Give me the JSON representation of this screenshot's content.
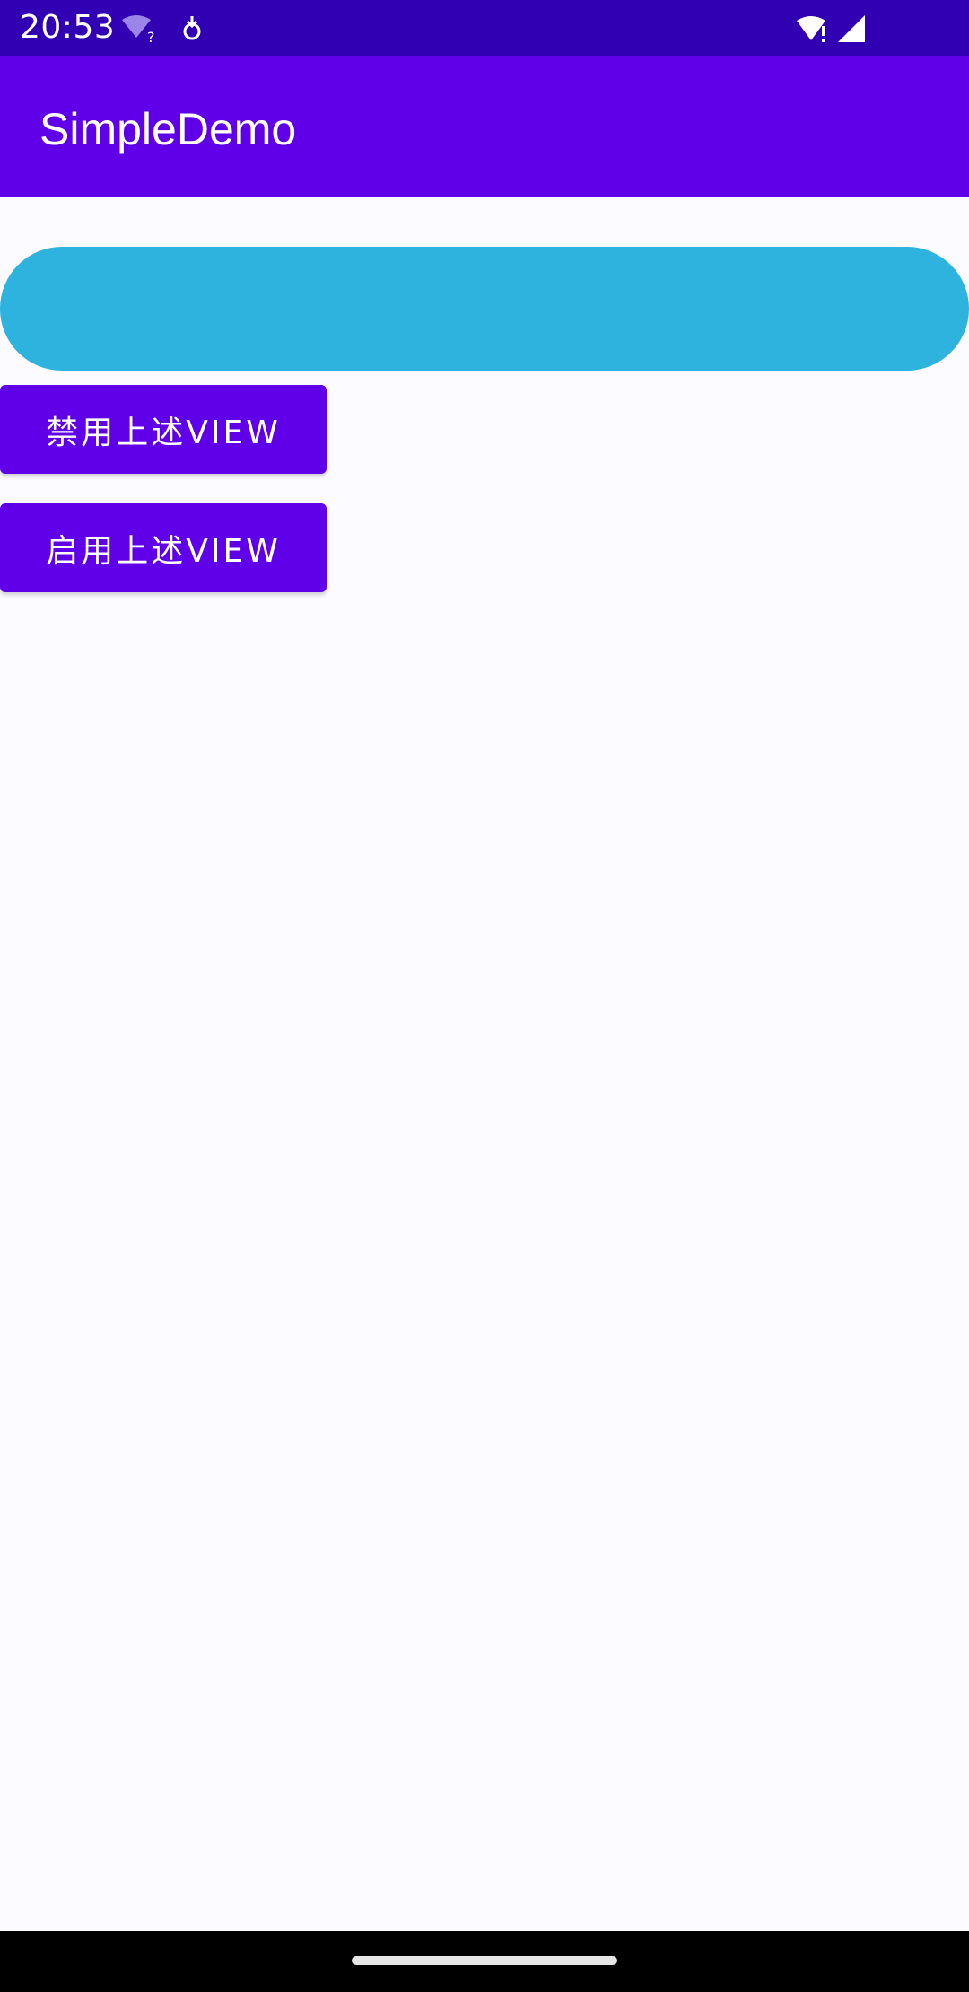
{
  "status_bar": {
    "time": "20:53",
    "left_icons": [
      "wifi-question-icon",
      "download-notification-icon"
    ],
    "right_icons": [
      "wifi-alert-icon",
      "cellular-signal-icon"
    ]
  },
  "app_bar": {
    "title": "SimpleDemo"
  },
  "main": {
    "pill_view": {
      "color": "#2db3dd"
    },
    "buttons": [
      {
        "label": "禁用上述VIEW"
      },
      {
        "label": "启用上述VIEW"
      }
    ]
  },
  "colors": {
    "status_bar": "#3200b3",
    "primary": "#5f00e9",
    "background": "#fcfbff"
  }
}
